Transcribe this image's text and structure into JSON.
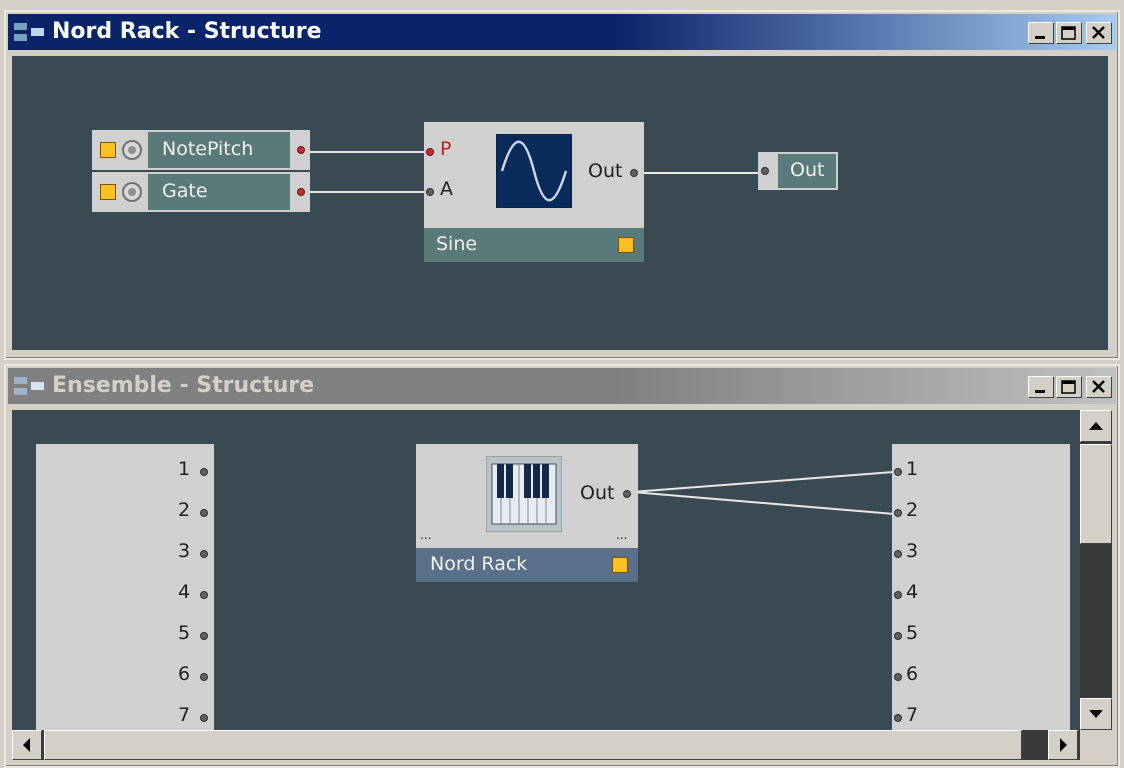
{
  "windows": {
    "nord_rack": {
      "title": "Nord Rack - Structure",
      "modules": {
        "note_pitch": "NotePitch",
        "gate": "Gate",
        "sine": {
          "name": "Sine",
          "port_p": "P",
          "port_a": "A",
          "out": "Out"
        },
        "out": "Out"
      }
    },
    "ensemble": {
      "title": "Ensemble - Structure",
      "left_ports": [
        "1",
        "2",
        "3",
        "4",
        "5",
        "6",
        "7"
      ],
      "right_ports": [
        "1",
        "2",
        "3",
        "4",
        "5",
        "6",
        "7"
      ],
      "nord_rack_module": {
        "name": "Nord Rack",
        "out": "Out",
        "dots_left": "...",
        "dots_right": "..."
      }
    }
  },
  "colors": {
    "active_title": "#0a246a",
    "inactive_title": "#808080",
    "canvas": "#394a52",
    "accent": "#f8c020"
  },
  "icons": [
    "structure-icon",
    "midi-icon",
    "sine-wave-icon",
    "piano-icon",
    "minimize-icon",
    "maximize-icon",
    "close-icon",
    "scroll-up-icon",
    "scroll-down-icon",
    "scroll-left-icon",
    "scroll-right-icon"
  ]
}
